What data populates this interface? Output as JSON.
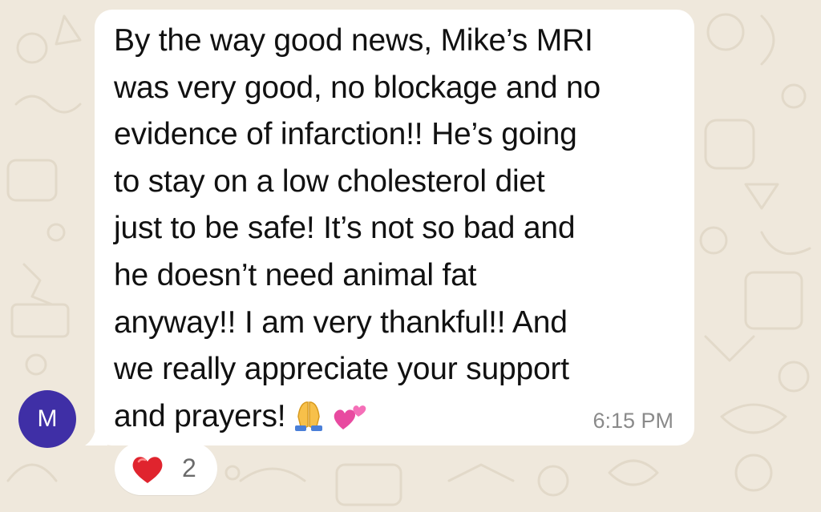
{
  "message": {
    "lines": [
      "By the way good news, Mike’s MRI",
      "was very good, no blockage and no",
      "evidence of infarction!! He’s going",
      "to stay on a low cholesterol diet",
      "just to be safe! It’s not so bad and",
      "he doesn’t need animal fat",
      "anyway!! I am very thankful!!  And",
      "we really appreciate your support",
      "and prayers!"
    ],
    "emojis": [
      "folded-hands-icon",
      "two-hearts-icon"
    ],
    "time": "6:15 PM"
  },
  "sender": {
    "initial": "M",
    "avatar_color": "#3f2fa6"
  },
  "reaction": {
    "emoji": "red-heart-icon",
    "count": "2"
  },
  "colors": {
    "background": "#efe8dc",
    "bubble": "#ffffff",
    "timestamp": "#8a8a8a"
  }
}
